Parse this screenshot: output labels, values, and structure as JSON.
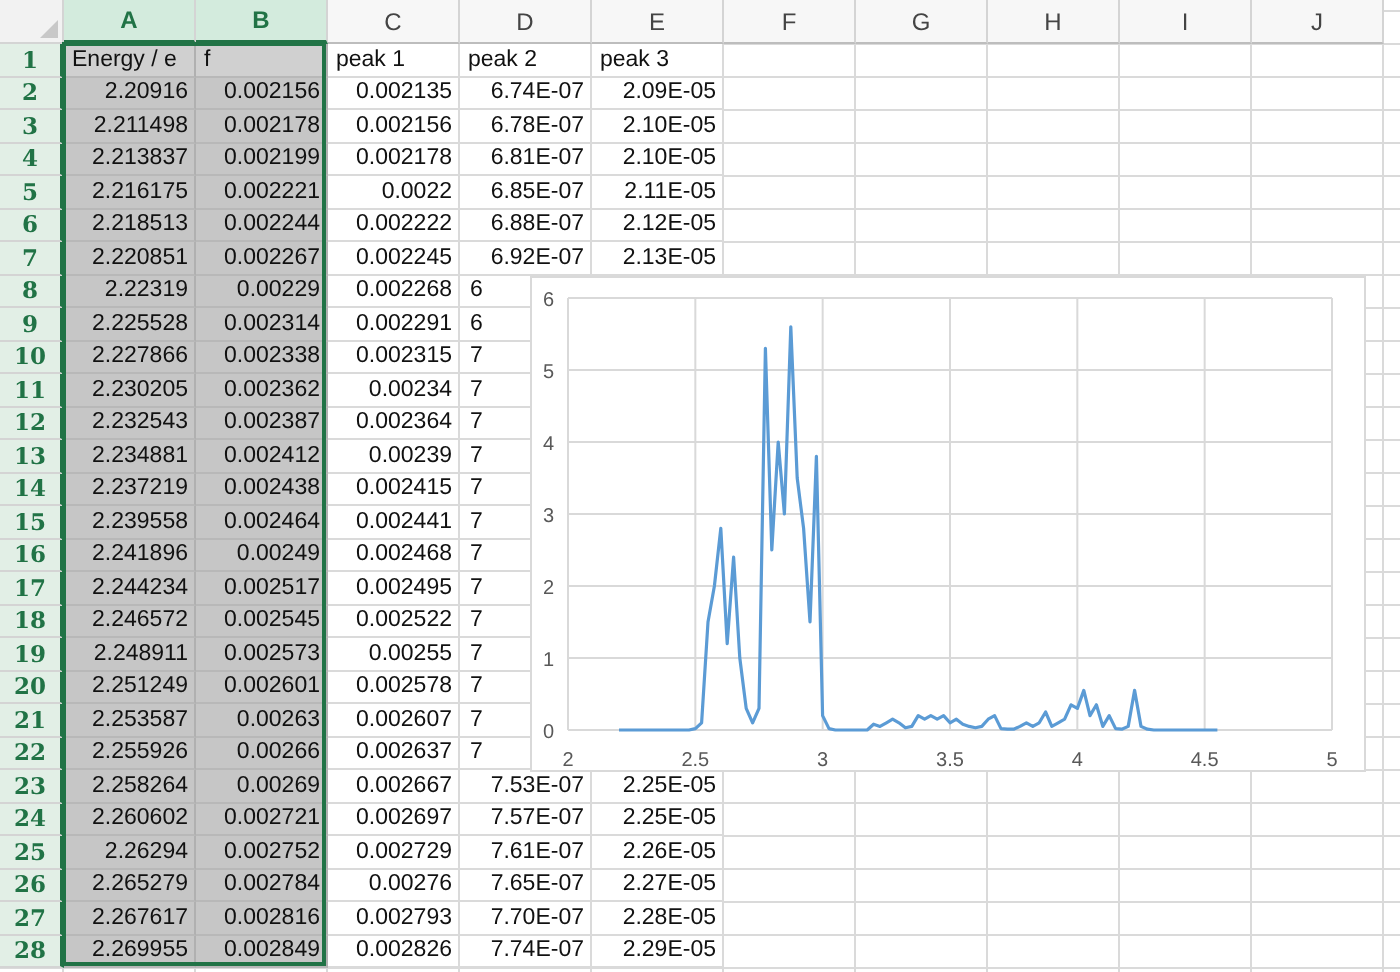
{
  "columns": [
    {
      "label": "A",
      "selected": true
    },
    {
      "label": "B",
      "selected": true
    },
    {
      "label": "C",
      "selected": false
    },
    {
      "label": "D",
      "selected": false
    },
    {
      "label": "E",
      "selected": false
    },
    {
      "label": "F",
      "selected": false
    },
    {
      "label": "G",
      "selected": false
    },
    {
      "label": "H",
      "selected": false
    },
    {
      "label": "I",
      "selected": false
    },
    {
      "label": "J",
      "selected": false
    }
  ],
  "rows": [
    {
      "number": "1",
      "selected": true,
      "covered": false,
      "cells": [
        "Energy / e",
        "f",
        "peak 1",
        "peak 2",
        "peak 3"
      ]
    },
    {
      "number": "2",
      "selected": true,
      "covered": false,
      "cells": [
        "2.20916",
        "0.002156",
        "0.002135",
        "6.74E-07",
        "2.09E-05"
      ]
    },
    {
      "number": "3",
      "selected": true,
      "covered": false,
      "cells": [
        "2.211498",
        "0.002178",
        "0.002156",
        "6.78E-07",
        "2.10E-05"
      ]
    },
    {
      "number": "4",
      "selected": true,
      "covered": false,
      "cells": [
        "2.213837",
        "0.002199",
        "0.002178",
        "6.81E-07",
        "2.10E-05"
      ]
    },
    {
      "number": "5",
      "selected": true,
      "covered": false,
      "cells": [
        "2.216175",
        "0.002221",
        "0.0022",
        "6.85E-07",
        "2.11E-05"
      ]
    },
    {
      "number": "6",
      "selected": true,
      "covered": false,
      "cells": [
        "2.218513",
        "0.002244",
        "0.002222",
        "6.88E-07",
        "2.12E-05"
      ]
    },
    {
      "number": "7",
      "selected": true,
      "covered": false,
      "cells": [
        "2.220851",
        "0.002267",
        "0.002245",
        "6.92E-07",
        "2.13E-05"
      ]
    },
    {
      "number": "8",
      "selected": true,
      "covered": true,
      "cells": [
        "2.22319",
        "0.00229",
        "0.002268",
        "6"
      ]
    },
    {
      "number": "9",
      "selected": true,
      "covered": true,
      "cells": [
        "2.225528",
        "0.002314",
        "0.002291",
        "6"
      ]
    },
    {
      "number": "10",
      "selected": true,
      "covered": true,
      "cells": [
        "2.227866",
        "0.002338",
        "0.002315",
        "7"
      ]
    },
    {
      "number": "11",
      "selected": true,
      "covered": true,
      "cells": [
        "2.230205",
        "0.002362",
        "0.00234",
        "7"
      ]
    },
    {
      "number": "12",
      "selected": true,
      "covered": true,
      "cells": [
        "2.232543",
        "0.002387",
        "0.002364",
        "7"
      ]
    },
    {
      "number": "13",
      "selected": true,
      "covered": true,
      "cells": [
        "2.234881",
        "0.002412",
        "0.00239",
        "7"
      ]
    },
    {
      "number": "14",
      "selected": true,
      "covered": true,
      "cells": [
        "2.237219",
        "0.002438",
        "0.002415",
        "7"
      ]
    },
    {
      "number": "15",
      "selected": true,
      "covered": true,
      "cells": [
        "2.239558",
        "0.002464",
        "0.002441",
        "7"
      ]
    },
    {
      "number": "16",
      "selected": true,
      "covered": true,
      "cells": [
        "2.241896",
        "0.00249",
        "0.002468",
        "7"
      ]
    },
    {
      "number": "17",
      "selected": true,
      "covered": true,
      "cells": [
        "2.244234",
        "0.002517",
        "0.002495",
        "7"
      ]
    },
    {
      "number": "18",
      "selected": true,
      "covered": true,
      "cells": [
        "2.246572",
        "0.002545",
        "0.002522",
        "7"
      ]
    },
    {
      "number": "19",
      "selected": true,
      "covered": true,
      "cells": [
        "2.248911",
        "0.002573",
        "0.00255",
        "7"
      ]
    },
    {
      "number": "20",
      "selected": true,
      "covered": true,
      "cells": [
        "2.251249",
        "0.002601",
        "0.002578",
        "7"
      ]
    },
    {
      "number": "21",
      "selected": true,
      "covered": true,
      "cells": [
        "2.253587",
        "0.00263",
        "0.002607",
        "7"
      ]
    },
    {
      "number": "22",
      "selected": true,
      "covered": true,
      "cells": [
        "2.255926",
        "0.00266",
        "0.002637",
        "7"
      ]
    },
    {
      "number": "23",
      "selected": true,
      "covered": false,
      "cells": [
        "2.258264",
        "0.00269",
        "0.002667",
        "7.53E-07",
        "2.25E-05"
      ]
    },
    {
      "number": "24",
      "selected": true,
      "covered": false,
      "cells": [
        "2.260602",
        "0.002721",
        "0.002697",
        "7.57E-07",
        "2.25E-05"
      ]
    },
    {
      "number": "25",
      "selected": true,
      "covered": false,
      "cells": [
        "2.26294",
        "0.002752",
        "0.002729",
        "7.61E-07",
        "2.26E-05"
      ]
    },
    {
      "number": "26",
      "selected": true,
      "covered": false,
      "cells": [
        "2.265279",
        "0.002784",
        "0.00276",
        "7.65E-07",
        "2.27E-05"
      ]
    },
    {
      "number": "27",
      "selected": true,
      "covered": false,
      "cells": [
        "2.267617",
        "0.002816",
        "0.002793",
        "7.70E-07",
        "2.28E-05"
      ]
    },
    {
      "number": "28",
      "selected": true,
      "covered": false,
      "cells": [
        "2.269955",
        "0.002849",
        "0.002826",
        "7.74E-07",
        "2.29E-05"
      ]
    }
  ],
  "chart": {
    "chart_data": {
      "type": "line",
      "x": [
        2.2,
        2.225,
        2.25,
        2.275,
        2.3,
        2.325,
        2.35,
        2.375,
        2.4,
        2.425,
        2.45,
        2.475,
        2.5,
        2.525,
        2.55,
        2.575,
        2.6,
        2.625,
        2.65,
        2.675,
        2.7,
        2.725,
        2.75,
        2.775,
        2.8,
        2.825,
        2.85,
        2.875,
        2.9,
        2.925,
        2.95,
        2.975,
        3,
        3.025,
        3.05,
        3.075,
        3.1,
        3.125,
        3.15,
        3.175,
        3.2,
        3.225,
        3.25,
        3.275,
        3.3,
        3.325,
        3.35,
        3.375,
        3.4,
        3.425,
        3.45,
        3.475,
        3.5,
        3.525,
        3.55,
        3.575,
        3.6,
        3.625,
        3.65,
        3.675,
        3.7,
        3.725,
        3.75,
        3.775,
        3.8,
        3.825,
        3.85,
        3.875,
        3.9,
        3.925,
        3.95,
        3.975,
        4,
        4.025,
        4.05,
        4.075,
        4.1,
        4.125,
        4.15,
        4.175,
        4.2,
        4.225,
        4.25,
        4.275,
        4.3,
        4.325,
        4.35,
        4.375,
        4.4,
        4.425,
        4.45,
        4.475,
        4.5,
        4.525,
        4.55
      ],
      "series": [
        {
          "color": "#5b9bd5",
          "values": [
            0,
            0,
            0,
            0,
            0,
            0,
            0,
            0,
            0,
            0,
            0,
            0,
            0.02,
            0.1,
            1.5,
            2.0,
            2.8,
            1.2,
            2.4,
            1.0,
            0.3,
            0.1,
            0.3,
            5.3,
            2.5,
            4.0,
            3.0,
            5.6,
            3.5,
            2.8,
            1.5,
            3.8,
            0.2,
            0.02,
            0,
            0,
            0,
            0,
            0,
            0,
            0.08,
            0.05,
            0.1,
            0.15,
            0.1,
            0.03,
            0.05,
            0.2,
            0.15,
            0.2,
            0.15,
            0.2,
            0.1,
            0.15,
            0.08,
            0.05,
            0.03,
            0.05,
            0.15,
            0.2,
            0.02,
            0.01,
            0.01,
            0.05,
            0.1,
            0.05,
            0.1,
            0.25,
            0.05,
            0.1,
            0.15,
            0.35,
            0.3,
            0.55,
            0.2,
            0.35,
            0.05,
            0.2,
            0.02,
            0.01,
            0.05,
            0.55,
            0.05,
            0.01,
            0,
            0,
            0,
            0,
            0,
            0,
            0,
            0,
            0,
            0,
            0
          ]
        }
      ],
      "xlim": [
        2,
        5
      ],
      "ylim": [
        0,
        6
      ],
      "grid": true,
      "xticks": [
        2,
        2.5,
        3,
        3.5,
        4,
        4.5,
        5
      ],
      "yticks": [
        0,
        1,
        2,
        3,
        4,
        5,
        6
      ]
    }
  }
}
